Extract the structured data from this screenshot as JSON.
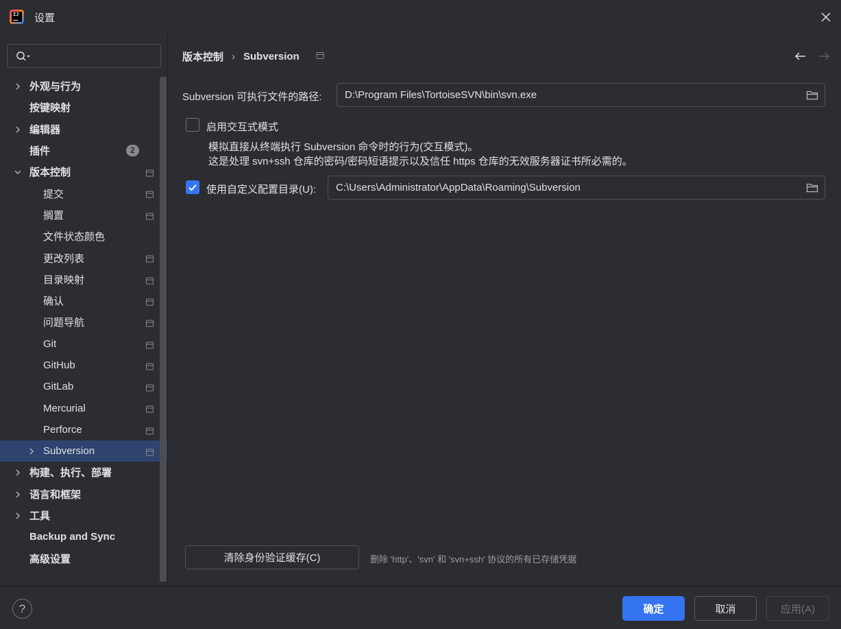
{
  "window": {
    "title": "设置"
  },
  "colors": {
    "accent": "#3574f0",
    "selection": "#2e436e",
    "background": "#2b2d30"
  },
  "search": {
    "placeholder": "",
    "value": ""
  },
  "sidebar": {
    "items": [
      {
        "label": "外观与行为",
        "level": 0,
        "expandable": true,
        "expanded": false,
        "project_icon": false
      },
      {
        "label": "按键映射",
        "level": 0,
        "expandable": false,
        "project_icon": false
      },
      {
        "label": "编辑器",
        "level": 0,
        "expandable": true,
        "expanded": false,
        "project_icon": false
      },
      {
        "label": "插件",
        "level": 0,
        "expandable": false,
        "badge": "2",
        "project_icon": false
      },
      {
        "label": "版本控制",
        "level": 0,
        "expandable": true,
        "expanded": true,
        "project_icon": true
      },
      {
        "label": "提交",
        "level": 1,
        "project_icon": true
      },
      {
        "label": "搁置",
        "level": 1,
        "project_icon": true
      },
      {
        "label": "文件状态颜色",
        "level": 1,
        "project_icon": false
      },
      {
        "label": "更改列表",
        "level": 1,
        "project_icon": true
      },
      {
        "label": "目录映射",
        "level": 1,
        "project_icon": true
      },
      {
        "label": "确认",
        "level": 1,
        "project_icon": true
      },
      {
        "label": "问题导航",
        "level": 1,
        "project_icon": true
      },
      {
        "label": "Git",
        "level": 1,
        "project_icon": true
      },
      {
        "label": "GitHub",
        "level": 1,
        "project_icon": true
      },
      {
        "label": "GitLab",
        "level": 1,
        "project_icon": true
      },
      {
        "label": "Mercurial",
        "level": 1,
        "project_icon": true
      },
      {
        "label": "Perforce",
        "level": 1,
        "project_icon": true
      },
      {
        "label": "Subversion",
        "level": 1,
        "expandable": true,
        "expanded": false,
        "selected": true,
        "project_icon": true
      },
      {
        "label": "构建、执行、部署",
        "level": 0,
        "expandable": true,
        "expanded": false,
        "project_icon": false
      },
      {
        "label": "语言和框架",
        "level": 0,
        "expandable": true,
        "expanded": false,
        "project_icon": false
      },
      {
        "label": "工具",
        "level": 0,
        "expandable": true,
        "expanded": false,
        "project_icon": false
      },
      {
        "label": "Backup and Sync",
        "level": 0,
        "expandable": false,
        "project_icon": false
      },
      {
        "label": "高级设置",
        "level": 0,
        "expandable": false,
        "project_icon": false
      }
    ]
  },
  "breadcrumb": {
    "parent": "版本控制",
    "separator": "›",
    "current": "Subversion"
  },
  "settings": {
    "exe_path_label": "Subversion 可执行文件的路径:",
    "exe_path_value": "D:\\Program Files\\TortoiseSVN\\bin\\svn.exe",
    "interactive_label": "启用交互式模式",
    "interactive_checked": false,
    "interactive_desc_1": "模拟直接从终端执行 Subversion 命令时的行为(交互模式)。",
    "interactive_desc_2": "这是处理 svn+ssh 仓库的密码/密码短语提示以及信任 https 仓库的无效服务器证书所必需的。",
    "custom_config_label": "使用自定义配置目录(U):",
    "custom_config_checked": true,
    "custom_config_value": "C:\\Users\\Administrator\\AppData\\Roaming\\Subversion",
    "clear_cache_button": "清除身份验证缓存(C)",
    "clear_cache_hint": "删除 'http'、'svn' 和 'svn+ssh' 协议的所有已存储凭据"
  },
  "footer": {
    "help": "?",
    "ok": "确定",
    "cancel": "取消",
    "apply": "应用(A)"
  }
}
